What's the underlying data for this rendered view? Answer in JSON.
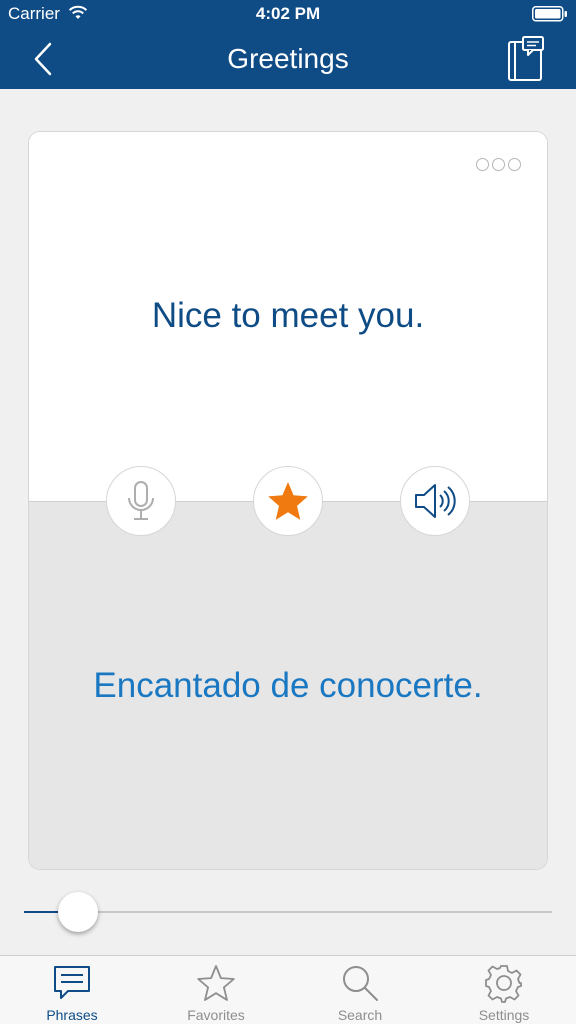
{
  "status_bar": {
    "carrier": "Carrier",
    "time": "4:02 PM",
    "icons": [
      "wifi-icon",
      "battery-icon"
    ]
  },
  "nav": {
    "title": "Greetings",
    "back_icon": "chevron-left-icon",
    "right_icon": "phrasebook-icon"
  },
  "card": {
    "phrase": "Nice to meet you.",
    "translation": "Encantado de conocerte.",
    "actions": [
      {
        "icon": "microphone-icon"
      },
      {
        "icon": "star-icon",
        "active": true
      },
      {
        "icon": "speaker-icon"
      }
    ],
    "more_icon": "more-dots-icon"
  },
  "slider": {
    "value_fraction": 0.07
  },
  "tabs": [
    {
      "label": "Phrases",
      "icon": "speech-bubble-icon",
      "active": true
    },
    {
      "label": "Favorites",
      "icon": "star-outline-icon",
      "active": false
    },
    {
      "label": "Search",
      "icon": "search-icon",
      "active": false
    },
    {
      "label": "Settings",
      "icon": "gear-icon",
      "active": false
    }
  ],
  "colors": {
    "brand": "#0f4c86",
    "translation": "#1a78c2",
    "star": "#f07a10",
    "inactive_tab": "#8e8e8e"
  }
}
